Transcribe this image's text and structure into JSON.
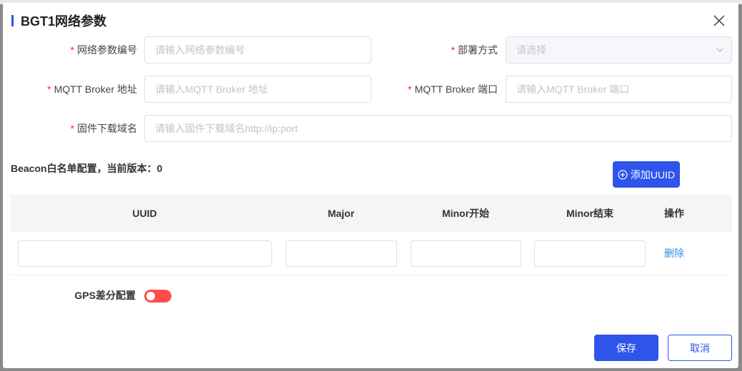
{
  "dialog": {
    "title": "BGT1网络参数",
    "close_icon": "close-icon"
  },
  "form": {
    "required_mark": "*",
    "param_code": {
      "label": "网络参数编号",
      "placeholder": "请输入网络参数编号",
      "value": ""
    },
    "deploy_mode": {
      "label": "部署方式",
      "placeholder": "请选择",
      "value": ""
    },
    "broker_addr": {
      "label": "MQTT Broker 地址",
      "placeholder": "请输入MQTT Broker 地址",
      "value": ""
    },
    "broker_port": {
      "label": "MQTT Broker 端口",
      "placeholder": "请输入MQTT Broker 端口",
      "value": ""
    },
    "firmware_domain": {
      "label": "固件下载域名",
      "placeholder": "请输入固件下载域名http://ip:port",
      "value": ""
    }
  },
  "beacon": {
    "section_title": "Beacon白名单配置，当前版本：0",
    "add_label": "添加UUID",
    "columns": [
      "UUID",
      "Major",
      "Minor开始",
      "Minor结束",
      "操作"
    ],
    "rows": [
      {
        "uuid": "",
        "major": "",
        "minor_start": "",
        "minor_end": "",
        "action": "删除"
      }
    ]
  },
  "gps": {
    "label": "GPS差分配置",
    "enabled": false
  },
  "footer": {
    "save_label": "保存",
    "cancel_label": "取消"
  },
  "colors": {
    "primary": "#2f54eb",
    "required": "#f5222d",
    "toggle_off": "#ff4d4f",
    "link": "#2f8ee8"
  }
}
